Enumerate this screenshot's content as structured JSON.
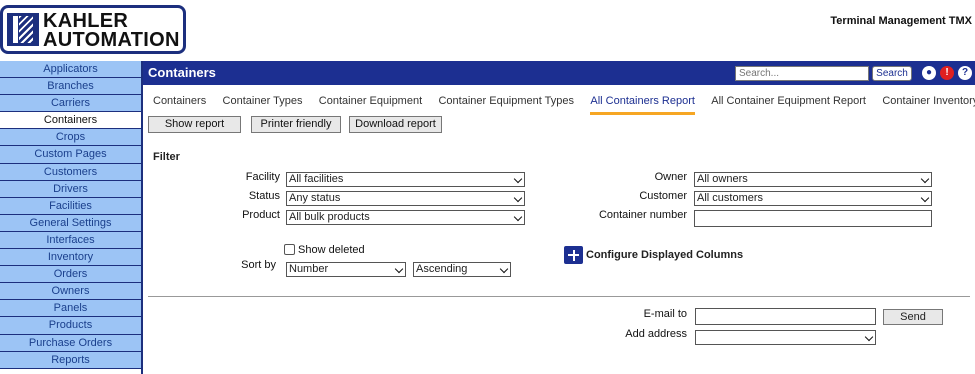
{
  "brand": {
    "logo_line1": "KAHLER",
    "logo_line2": "AUTOMATION",
    "app_title": "Terminal Management TMX"
  },
  "sidebar": {
    "items": [
      {
        "label": "Applicators"
      },
      {
        "label": "Branches"
      },
      {
        "label": "Carriers"
      },
      {
        "label": "Containers",
        "active": true
      },
      {
        "label": "Crops"
      },
      {
        "label": "Custom Pages"
      },
      {
        "label": "Customers"
      },
      {
        "label": "Drivers"
      },
      {
        "label": "Facilities"
      },
      {
        "label": "General Settings"
      },
      {
        "label": "Interfaces"
      },
      {
        "label": "Inventory"
      },
      {
        "label": "Orders"
      },
      {
        "label": "Owners"
      },
      {
        "label": "Panels"
      },
      {
        "label": "Products"
      },
      {
        "label": "Purchase Orders"
      },
      {
        "label": "Reports"
      }
    ]
  },
  "topbar": {
    "title": "Containers",
    "search_placeholder": "Search...",
    "search_button": "Search",
    "user_icon": "user-icon",
    "alert_icon": "alert-icon",
    "alert_glyph": "!",
    "help_icon": "help-icon",
    "help_glyph": "?"
  },
  "tabs": [
    {
      "label": "Containers"
    },
    {
      "label": "Container Types"
    },
    {
      "label": "Container Equipment"
    },
    {
      "label": "Container Equipment Types"
    },
    {
      "label": "All Containers Report",
      "active": true
    },
    {
      "label": "All Container Equipment Report"
    },
    {
      "label": "Container Inventory"
    }
  ],
  "actions": {
    "show_report": "Show report",
    "printer_friendly": "Printer friendly",
    "download_report": "Download report"
  },
  "filter": {
    "title": "Filter",
    "facility_label": "Facility",
    "facility_value": "All facilities",
    "status_label": "Status",
    "status_value": "Any status",
    "product_label": "Product",
    "product_value": "All bulk products",
    "owner_label": "Owner",
    "owner_value": "All owners",
    "customer_label": "Customer",
    "customer_value": "All customers",
    "container_number_label": "Container number",
    "container_number_value": "",
    "show_deleted_label": "Show deleted",
    "show_deleted_checked": false,
    "sort_by_label": "Sort by",
    "sort_field": "Number",
    "sort_order": "Ascending",
    "configure_columns_label": "Configure Displayed Columns"
  },
  "email": {
    "email_to_label": "E-mail to",
    "email_to_value": "",
    "send_button": "Send",
    "add_address_label": "Add address",
    "add_address_value": ""
  },
  "colors": {
    "primary": "#1c2f91",
    "sidebar_bg": "#9cc4f5",
    "tab_accent": "#f6a623",
    "alert": "#e02020"
  }
}
